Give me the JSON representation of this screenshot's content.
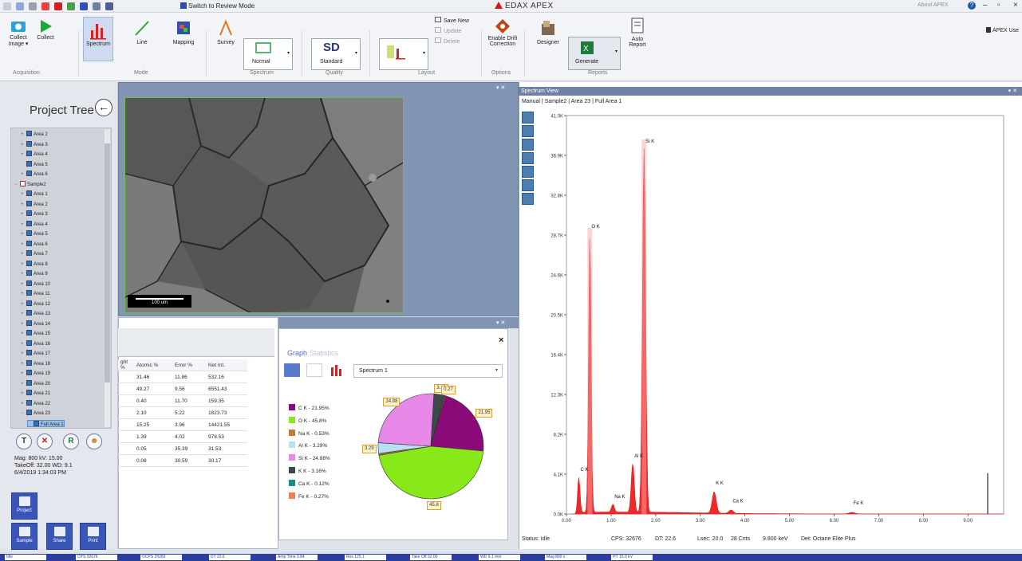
{
  "app": {
    "title": "EDAX APEX",
    "review_mode": "Switch to Review Mode",
    "about": "About APEX",
    "help": "?",
    "user": "APEX Use",
    "window_controls": [
      "–",
      "▫",
      "×"
    ]
  },
  "ribbon": {
    "buttons": [
      {
        "id": "collect-image",
        "label": "Collect Image ▾"
      },
      {
        "id": "collect",
        "label": "Collect"
      },
      {
        "id": "spectrum",
        "label": "Spectrum"
      },
      {
        "id": "line",
        "label": "Line"
      },
      {
        "id": "mapping",
        "label": "Mapping"
      },
      {
        "id": "survey",
        "label": "Survey"
      },
      {
        "id": "normal",
        "label": "Normal"
      },
      {
        "id": "standard",
        "label": "Standard",
        "big": "SD"
      },
      {
        "id": "save-new",
        "label": "Save New"
      },
      {
        "id": "update",
        "label": "Update"
      },
      {
        "id": "delete",
        "label": "Delete"
      },
      {
        "id": "enable-drift",
        "label": "Enable Drift Correction"
      },
      {
        "id": "designer",
        "label": "Designer"
      },
      {
        "id": "generate",
        "label": "Generate"
      },
      {
        "id": "auto-report",
        "label": "Auto Report"
      }
    ],
    "groups": [
      "Acquisition",
      "Mode",
      "Spectrum",
      "Quality",
      "Layout",
      "Options",
      "Reports"
    ]
  },
  "project": {
    "title": "Project Tree",
    "tree": [
      {
        "label": "Area 2",
        "level": 2,
        "exp": "+"
      },
      {
        "label": "Area 3",
        "level": 2,
        "exp": "+"
      },
      {
        "label": "Area 4",
        "level": 2,
        "exp": "+"
      },
      {
        "label": "Area 5",
        "level": 2,
        "exp": ""
      },
      {
        "label": "Area 6",
        "level": 2,
        "exp": "+"
      },
      {
        "label": "Sample2",
        "level": 1,
        "exp": "−",
        "sample": true
      },
      {
        "label": "Area 1",
        "level": 2,
        "exp": "+"
      },
      {
        "label": "Area 2",
        "level": 2,
        "exp": "+"
      },
      {
        "label": "Area 3",
        "level": 2,
        "exp": "+"
      },
      {
        "label": "Area 4",
        "level": 2,
        "exp": "+"
      },
      {
        "label": "Area 5",
        "level": 2,
        "exp": "+"
      },
      {
        "label": "Area 6",
        "level": 2,
        "exp": "+"
      },
      {
        "label": "Area 7",
        "level": 2,
        "exp": "+"
      },
      {
        "label": "Area 8",
        "level": 2,
        "exp": "+"
      },
      {
        "label": "Area 9",
        "level": 2,
        "exp": "+"
      },
      {
        "label": "Area 10",
        "level": 2,
        "exp": "+"
      },
      {
        "label": "Area 11",
        "level": 2,
        "exp": "+"
      },
      {
        "label": "Area 12",
        "level": 2,
        "exp": "+"
      },
      {
        "label": "Area 13",
        "level": 2,
        "exp": "+"
      },
      {
        "label": "Area 14",
        "level": 2,
        "exp": "+"
      },
      {
        "label": "Area 15",
        "level": 2,
        "exp": "+"
      },
      {
        "label": "Area 16",
        "level": 2,
        "exp": "+"
      },
      {
        "label": "Area 17",
        "level": 2,
        "exp": "+"
      },
      {
        "label": "Area 18",
        "level": 2,
        "exp": "+"
      },
      {
        "label": "Area 19",
        "level": 2,
        "exp": "+"
      },
      {
        "label": "Area 20",
        "level": 2,
        "exp": "+"
      },
      {
        "label": "Area 21",
        "level": 2,
        "exp": "+"
      },
      {
        "label": "Area 22",
        "level": 2,
        "exp": "+"
      },
      {
        "label": "Area 23",
        "level": 2,
        "exp": "−"
      },
      {
        "label": "Full Area 1",
        "level": 3,
        "exp": "",
        "selected": true
      }
    ],
    "circle_buttons": [
      "T",
      "✕",
      "R",
      "☻"
    ],
    "info": [
      "Mag: 800 kV: 15.00",
      "TakeOff: 32.00 WD: 9.1",
      "6/4/2019 1:34:03 PM"
    ],
    "nav": {
      "project": "Project",
      "sample": "Sample",
      "share": "Share",
      "print": "Print"
    }
  },
  "image": {
    "scale_label": "100 um",
    "panel_controls": "▾ ✕"
  },
  "results": {
    "headers": [
      "ght %",
      "Atomic %",
      "Error %",
      "Net Int."
    ],
    "rows": [
      [
        "",
        "31.46",
        "11.86",
        "532.16"
      ],
      [
        "",
        "49.27",
        "9.56",
        "6551.43"
      ],
      [
        "",
        "0.40",
        "11.70",
        "159.35"
      ],
      [
        "",
        "2.10",
        "5.22",
        "1823.73"
      ],
      [
        "",
        "15.25",
        "3.96",
        "14421.55"
      ],
      [
        "",
        "1.39",
        "4.02",
        "978.53"
      ],
      [
        "",
        "0.05",
        "35.39",
        "31.53"
      ],
      [
        "",
        "0.08",
        "30.59",
        "30.17"
      ]
    ]
  },
  "graph": {
    "tab_graph": "Graph",
    "tab_stats": "Statistics",
    "close": "×",
    "spectrum_select": "Spectrum 1",
    "legend": [
      {
        "label": "C K - 21.95%",
        "color": "#8a0a7a"
      },
      {
        "label": "O K - 45.8%",
        "color": "#88e81a"
      },
      {
        "label": "Na K - 0.53%",
        "color": "#c87838"
      },
      {
        "label": "Al K - 3.29%",
        "color": "#b8e0f0"
      },
      {
        "label": "Si K - 24.88%",
        "color": "#e888e8"
      },
      {
        "label": "K K - 3.16%",
        "color": "#3a4a4a"
      },
      {
        "label": "Ca K - 0.12%",
        "color": "#10908a"
      },
      {
        "label": "Fe K - 0.27%",
        "color": "#f08050"
      }
    ],
    "pie": [
      {
        "label": "21.95",
        "value": 21.95,
        "color": "#8a0a7a"
      },
      {
        "label": "45.8",
        "value": 45.8,
        "color": "#88e81a"
      },
      {
        "label": "",
        "value": 0.53,
        "color": "#c87838"
      },
      {
        "label": "3.29",
        "value": 3.29,
        "color": "#b8e0f0"
      },
      {
        "label": "24.88",
        "value": 24.88,
        "color": "#e888e8"
      },
      {
        "label": "3.16",
        "value": 3.16,
        "color": "#3a4a4a"
      },
      {
        "label": "",
        "value": 0.12,
        "color": "#10908a"
      },
      {
        "label": "0.27",
        "value": 0.27,
        "color": "#f08050"
      }
    ]
  },
  "spectrum": {
    "title": "Spectrum View",
    "path": "Manual | Sample2 | Area 23 | Full Area 1",
    "status": [
      "Status: Idle",
      "CPS: 32676",
      "DT: 22.6",
      "Lsec: 20.0",
      "28 Cnts",
      "9.800 keV",
      "Det: Octane Elite Plus"
    ]
  },
  "chart_data": {
    "type": "line",
    "xlabel": "",
    "ylabel": "",
    "x_ticks": [
      "0.00",
      "1.00",
      "2.00",
      "3.00",
      "4.00",
      "5.00",
      "6.00",
      "7.00",
      "8.00",
      "9.00"
    ],
    "y_ticks": [
      "0.0K",
      "4.1K",
      "8.2K",
      "12.3K",
      "16.4K",
      "20.5K",
      "24.6K",
      "28.7K",
      "32.8K",
      "36.9K",
      "41.0K"
    ],
    "xlim": [
      0,
      9.8
    ],
    "ylim": [
      0,
      41000
    ],
    "peaks": [
      {
        "label": "C K",
        "x": 0.277,
        "y": 3600
      },
      {
        "label": "O K",
        "x": 0.525,
        "y": 28600
      },
      {
        "label": "Na K",
        "x": 1.041,
        "y": 800
      },
      {
        "label": "Al K",
        "x": 1.486,
        "y": 5000
      },
      {
        "label": "Si K",
        "x": 1.739,
        "y": 37400
      },
      {
        "label": "K K",
        "x": 3.312,
        "y": 2200
      },
      {
        "label": "Ca K",
        "x": 3.69,
        "y": 350
      },
      {
        "label": "Fe K",
        "x": 6.398,
        "y": 150
      }
    ]
  },
  "statusbar": [
    "Idle",
    "CPS 32676",
    "OCPS 25283",
    "DT 22.6",
    "Amp Time 3.84",
    "Res 125.1",
    "Take Off 32.00",
    "WD 9.1 mm",
    "Mag 800 x",
    "HT 15.0 kV"
  ]
}
